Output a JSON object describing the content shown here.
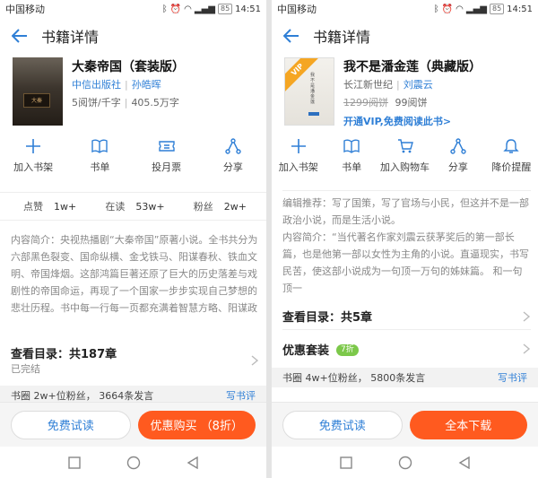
{
  "left": {
    "status": {
      "carrier": "中国移动",
      "battery": "85",
      "time": "14:51"
    },
    "appbar": {
      "title": "书籍详情"
    },
    "book": {
      "title": "大秦帝国（套装版）",
      "publisher": "中信出版社",
      "author": "孙皓晖",
      "price": "5阅饼/千字",
      "words": "405.5万字"
    },
    "actions": [
      "加入书架",
      "书单",
      "投月票",
      "分享"
    ],
    "stats": [
      {
        "label": "点赞",
        "value": "1w+"
      },
      {
        "label": "在读",
        "value": "53w+"
      },
      {
        "label": "粉丝",
        "value": "2w+"
      }
    ],
    "intro": "内容简介：央视热播剧“大秦帝国”原著小说。全书共分为六部黑色裂变、国命纵横、金戈铁马、阳谋春秋、铁血文明、帝国烽烟。这部鸿篇巨著还原了巨大的历史落差与戏剧性的帝国命运，再现了一个国家一步步实现自己梦想的悲壮历程。书中每一行每一页都充满着智慧方略、阳谋政",
    "toc": {
      "title": "查看目录：共187章",
      "sub": "已完结"
    },
    "community": {
      "text": "书圈 2w+位粉丝，  3664条发言",
      "link": "写书评"
    },
    "buttons": {
      "free": "免费试读",
      "buy": "优惠购买 （8折）"
    }
  },
  "right": {
    "status": {
      "carrier": "中国移动",
      "battery": "85",
      "time": "14:51"
    },
    "appbar": {
      "title": "书籍详情"
    },
    "book": {
      "title": "我不是潘金莲（典藏版）",
      "publisher": "长江新世纪",
      "author": "刘震云",
      "old_price": "1299阅饼",
      "new_price": "99阅饼",
      "vip_link": "开通VIP,免费阅读此书>",
      "cover_vip": "VIP"
    },
    "actions": [
      "加入书架",
      "书单",
      "加入购物车",
      "分享",
      "降价提醒"
    ],
    "intro": "编辑推荐：写了国策，写了官场与小民，但这并不是一部政治小说，而是生活小说。\n内容简介：“当代著名作家刘震云获茅奖后的第一部长篇，也是他第一部以女性为主角的小说。直逼现实，书写民苦，使这部小说成为一句顶一万句的姊妹篇。 和一句顶一",
    "toc": {
      "title": "查看目录：共5章"
    },
    "bundle": {
      "title": "优惠套装",
      "tag": "7折"
    },
    "community": {
      "text": "书圈 4w+位粉丝，  5800条发言",
      "link": "写书评"
    },
    "buttons": {
      "free": "免费试读",
      "buy": "全本下载"
    }
  },
  "colors": {
    "accent": "#2f7fd6",
    "buy": "#ff5a1f",
    "tag": "#7cc84a"
  },
  "icons": [
    "back-arrow-icon",
    "plus-icon",
    "book-icon",
    "ticket-icon",
    "share-icon",
    "cart-icon",
    "bell-icon",
    "chevron-right-icon"
  ]
}
